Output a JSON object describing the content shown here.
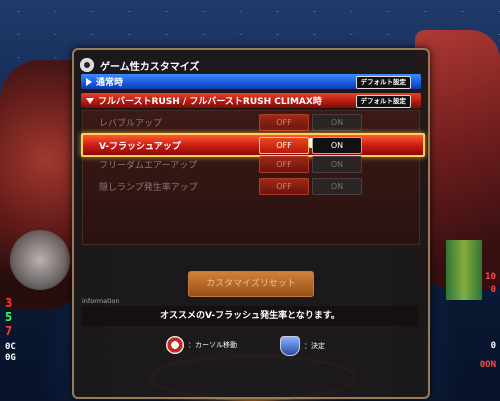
{
  "panel": {
    "title": "ゲーム性カスタマイズ"
  },
  "sections": [
    {
      "label": "通常時",
      "default_label": "デフォルト設定",
      "expanded": false
    },
    {
      "label": "フルバーストRUSH / フルバーストRUSH CLIMAX時",
      "default_label": "デフォルト設定",
      "expanded": true
    }
  ],
  "settings": [
    {
      "label": "レバブルアップ",
      "off": "OFF",
      "on": "ON",
      "value": "OFF",
      "selected": false
    },
    {
      "label": "V-フラッシュアップ",
      "off": "OFF",
      "on": "ON",
      "value": "OFF",
      "selected": true
    },
    {
      "label": "フリーダムエアーアップ",
      "off": "OFF",
      "on": "ON",
      "value": "OFF",
      "selected": false
    },
    {
      "label": "隠しランプ発生率アップ",
      "off": "OFF",
      "on": "ON",
      "value": "OFF",
      "selected": false
    }
  ],
  "reset_button": "カスタマイズリセット",
  "info": {
    "label": "information",
    "text": "オススメのV-フラッシュ発生率となります。"
  },
  "controls": [
    {
      "icon": "dpad-icon",
      "label": "：カーソル移動"
    },
    {
      "icon": "shield-button-icon",
      "label": "：決定"
    }
  ],
  "side_counters": {
    "left": [
      "3",
      "5",
      "7"
    ],
    "left_small": [
      "0C",
      "0G"
    ],
    "right": [
      "10",
      "0",
      "0",
      "0ON"
    ]
  },
  "colors": {
    "accent_blue": "#1a5adf",
    "accent_red": "#b01a10",
    "highlight": "#ffd050",
    "panel_border": "#9a7a58"
  }
}
